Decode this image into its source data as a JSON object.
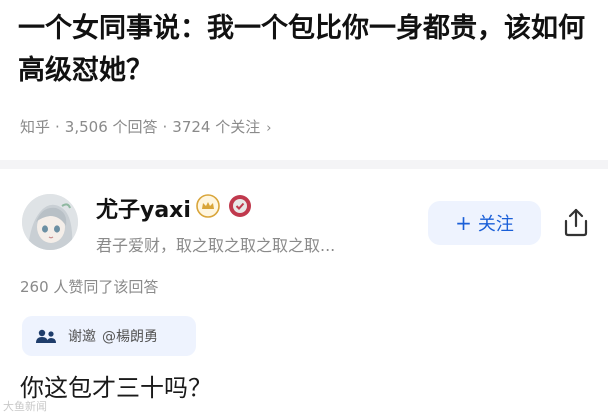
{
  "question": {
    "title": "一个女同事说：我一个包比你一身都贵，该如何高级怼她？",
    "source": "知乎",
    "follower_count": "3,506 个回答",
    "answer_count": "3724 个关注",
    "separator": "·",
    "chevron": "›"
  },
  "author": {
    "name": "尤子yaxi",
    "bio": "君子爱财，取之取之取之取之取...",
    "avatar_icon": "avatar-anime-girl",
    "badge_icons": [
      "crown-badge-icon",
      "verified-badge-icon"
    ]
  },
  "actions": {
    "follow_plus": "+",
    "follow_label": "关注",
    "share_icon": "share-icon"
  },
  "answer": {
    "votes_text": "260 人赞同了该回答",
    "invite_label": "谢邀",
    "invite_user": "@楊朗勇",
    "body": "你这包才三十吗？"
  },
  "watermark": {
    "text": "大鱼新闻"
  },
  "colors": {
    "accent": "#1a5fd8",
    "chip_bg": "#eef3fe",
    "muted_text": "#8a8a8a",
    "crown_gold": "#d9a53a",
    "verify_red": "#c0394d"
  }
}
